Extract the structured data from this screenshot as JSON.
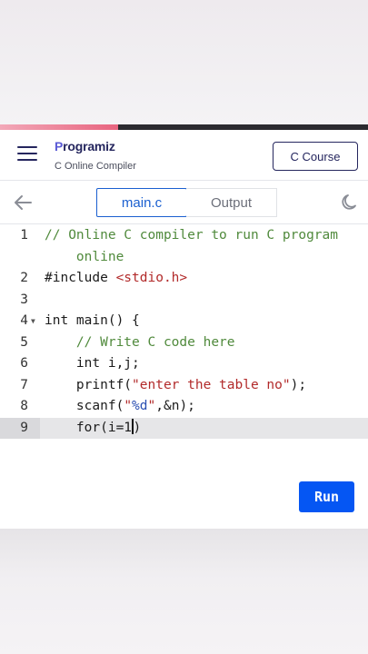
{
  "header": {
    "logo_text": "rogramiz",
    "logo_mark": "P",
    "subtitle": "C Online Compiler",
    "course_button": "C Course"
  },
  "toolbar": {
    "tabs": [
      {
        "label": "main.c",
        "active": true
      },
      {
        "label": "Output",
        "active": false
      }
    ],
    "back_icon": "arrow-left-icon",
    "theme_icon": "moon-icon"
  },
  "editor": {
    "line_numbers": [
      "1",
      "",
      "2",
      "3",
      "4",
      "5",
      "6",
      "7",
      "8",
      "9"
    ],
    "lines": [
      "// Online C compiler to run C program",
      "    online",
      "#include <stdio.h>",
      "",
      "int main() {",
      "    // Write C code here",
      "    int i,j;",
      "    printf(\"enter the table no\");",
      "    scanf(\"%d\",&n);",
      "    for(i=1)"
    ],
    "active_line": "9"
  },
  "run_button": "Run",
  "colors": {
    "accent": "#0556f3",
    "brand": "#25265e",
    "comment": "#508a3c",
    "string": "#b22a2a"
  }
}
